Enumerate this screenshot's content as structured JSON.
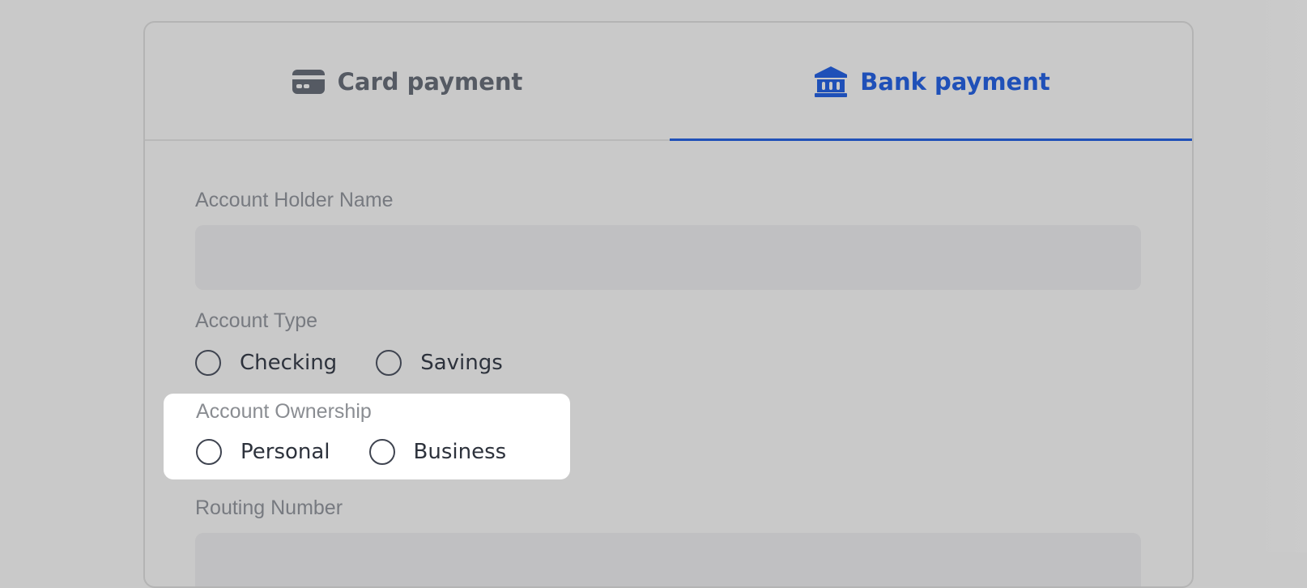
{
  "tabs": {
    "card": {
      "label": "Card payment",
      "icon": "credit-card-icon"
    },
    "bank": {
      "label": "Bank payment",
      "icon": "bank-icon",
      "active": true
    }
  },
  "form": {
    "account_holder": {
      "label": "Account Holder Name",
      "value": ""
    },
    "account_type": {
      "label": "Account Type",
      "options": [
        "Checking",
        "Savings"
      ],
      "selected": null
    },
    "account_ownership": {
      "label": "Account Ownership",
      "options": [
        "Personal",
        "Business"
      ],
      "selected": null
    },
    "routing_number": {
      "label": "Routing Number",
      "value": ""
    }
  },
  "colors": {
    "accent": "#1f50b8",
    "background": "#c9c9c9",
    "highlight": "#ffffff"
  }
}
